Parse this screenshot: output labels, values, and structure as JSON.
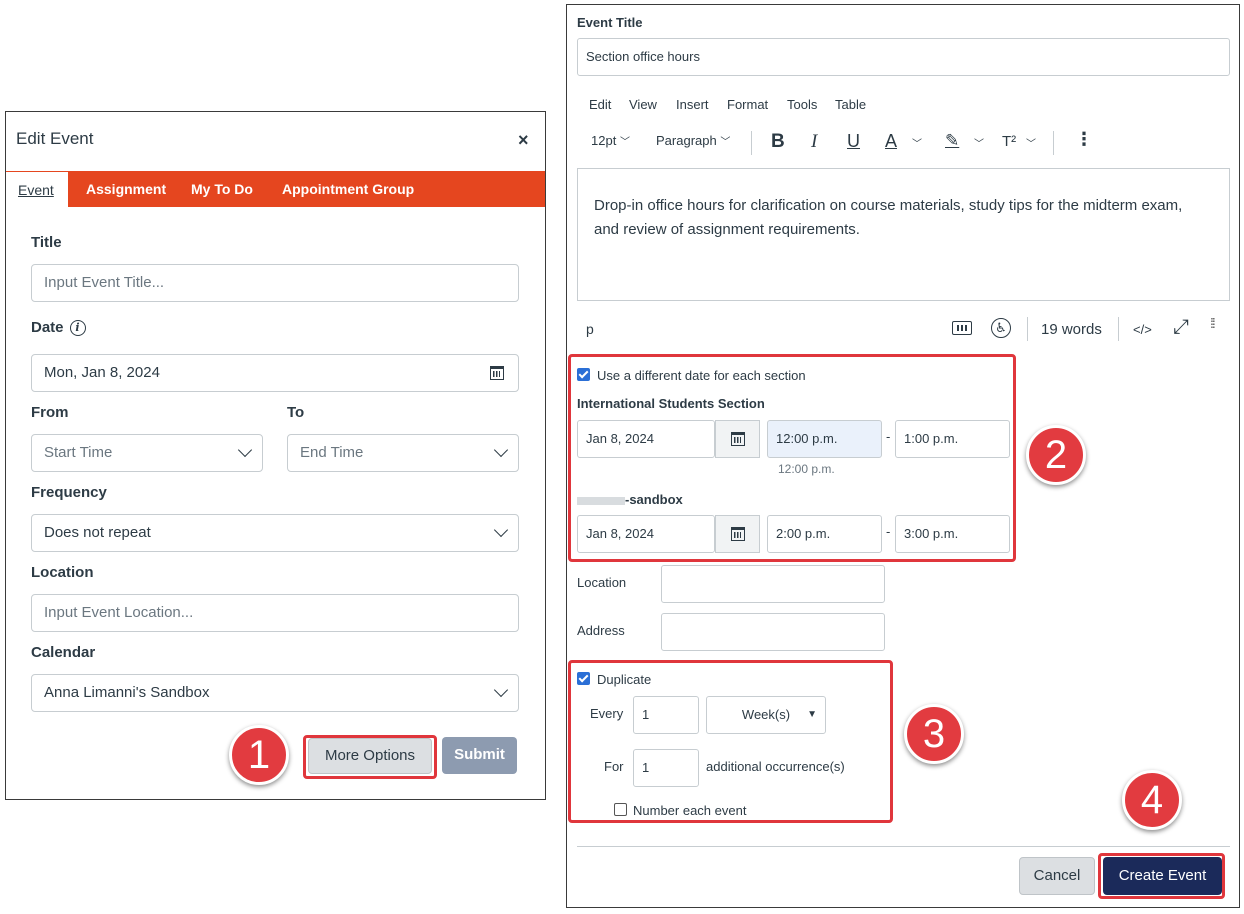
{
  "left_dialog": {
    "title": "Edit Event",
    "close_glyph": "×",
    "tabs": [
      "Event",
      "Assignment",
      "My To Do",
      "Appointment Group"
    ],
    "title_label": "Title",
    "title_placeholder": "Input Event Title...",
    "date_label": "Date",
    "date_info_glyph": "i",
    "date_value": "Mon, Jan 8, 2024",
    "from_label": "From",
    "to_label": "To",
    "from_placeholder": "Start Time",
    "to_placeholder": "End Time",
    "frequency_label": "Frequency",
    "frequency_value": "Does not repeat",
    "location_label": "Location",
    "location_placeholder": "Input Event Location...",
    "calendar_label": "Calendar",
    "calendar_value": "Anna Limanni's Sandbox",
    "more_options": "More Options",
    "submit": "Submit"
  },
  "right_panel": {
    "event_title_label": "Event Title",
    "event_title_value": "Section office hours",
    "menu": [
      "Edit",
      "View",
      "Insert",
      "Format",
      "Tools",
      "Table"
    ],
    "toolbar": {
      "font_size": "12pt",
      "block": "Paragraph",
      "bold": "B",
      "italic": "I",
      "underline": "U",
      "text_color": "A",
      "highlight": "✎",
      "superscript": "T²",
      "more": "⋮"
    },
    "editor_text": "Drop-in office hours for clarification on course materials, study tips for the midterm exam, and review of assignment requirements.",
    "status": {
      "path": "p",
      "word_count": "19 words",
      "html_toggle": "</>"
    },
    "different_date_label": "Use a different date for each section",
    "sections": [
      {
        "name": "International Students Section",
        "date": "Jan 8, 2024",
        "start": "12:00 p.m.",
        "end": "1:00 p.m.",
        "hint": "12:00 p.m."
      },
      {
        "name": "-sandbox",
        "date": "Jan 8, 2024",
        "start": "2:00 p.m.",
        "end": "3:00 p.m."
      }
    ],
    "dash": "-",
    "location_label": "Location",
    "address_label": "Address",
    "duplicate_label": "Duplicate",
    "every_label": "Every",
    "every_value": "1",
    "unit_value": "Week(s)",
    "for_label": "For",
    "for_value": "1",
    "occurrences_label": "additional occurrence(s)",
    "number_each_label": "Number each event",
    "cancel": "Cancel",
    "create": "Create Event"
  },
  "badges": [
    "1",
    "2",
    "3",
    "4"
  ],
  "colors": {
    "tab_bar": "#e5461f",
    "annotation_red": "#e0363c",
    "create_button": "#1b2a5a",
    "submit_button": "#8d9bb0",
    "checkbox": "#2b6fd6"
  }
}
